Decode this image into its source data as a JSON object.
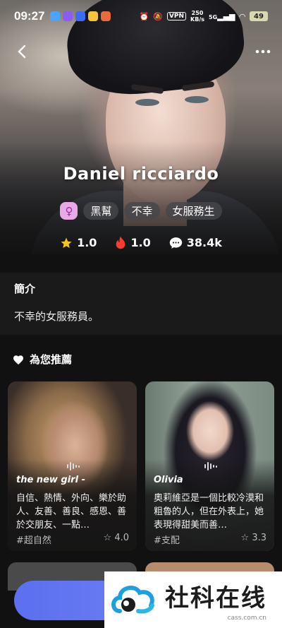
{
  "status_bar": {
    "time": "09:27",
    "vpn": "VPN",
    "speed": "250",
    "speed_unit": "KB/s",
    "network": "5G",
    "battery": "49"
  },
  "character": {
    "name": "Daniel ricciardo",
    "gender_symbol": "♀",
    "tags": [
      "黑幫",
      "不幸",
      "女服務生"
    ]
  },
  "stats": {
    "rating": "1.0",
    "heat": "1.0",
    "chats": "38.4k"
  },
  "intro": {
    "heading": "簡介",
    "text": "不幸的女服務員。"
  },
  "recommend": {
    "heading": "為您推薦"
  },
  "cards": [
    {
      "name": "the new girl -",
      "description": "自信、熱情、外向、樂於助人、友善、善良、感恩、善於交朋友、一點…",
      "tag": "#超自然",
      "rating": "4.0"
    },
    {
      "name": "Olivia",
      "description": "奧莉維亞是一個比較冷漠和粗魯的人，但在外表上，她表現得甜美而善…",
      "tag": "#支配",
      "rating": "3.3"
    }
  ],
  "watermark": {
    "text": "社科在线",
    "url": "cass.com.cn"
  },
  "colors": {
    "accent": "#5b6ff0",
    "star": "#f5c518",
    "fire": "#ff3b30"
  }
}
